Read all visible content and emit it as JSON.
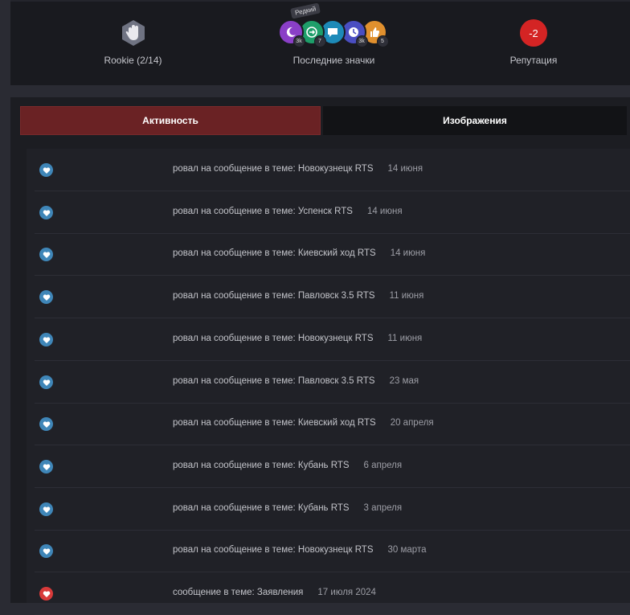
{
  "stats": {
    "rank": {
      "label": "Rookie (2/14)",
      "icon": "rank-hand-icon"
    },
    "badges": {
      "label": "Последние значки",
      "tooltip": "Редкий",
      "items": [
        {
          "icon": "moon-badge-icon",
          "color": "#8a3fc7",
          "count": "3k"
        },
        {
          "icon": "enter-badge-icon",
          "color": "#1e9e6a",
          "count": "7"
        },
        {
          "icon": "chat-badge-icon",
          "color": "#1d8ab8",
          "count": ""
        },
        {
          "icon": "clock-badge-icon",
          "color": "#4a4ec1",
          "count": "3k"
        },
        {
          "icon": "thumbs-up-badge-icon",
          "color": "#e0902e",
          "count": "5"
        }
      ]
    },
    "reputation": {
      "value": "-2",
      "label": "Репутация"
    }
  },
  "tabs": [
    {
      "label": "Активность",
      "active": true
    },
    {
      "label": "Изображения",
      "active": false
    }
  ],
  "activity": [
    {
      "text": "ровал на сообщение в теме: Новокузнецк RTS",
      "date": "14 июня"
    },
    {
      "text": "ровал на сообщение в теме: Успенск RTS",
      "date": "14 июня"
    },
    {
      "text": "ровал на сообщение в теме: Киевский ход RTS",
      "date": "14 июня"
    },
    {
      "text": "ровал на сообщение в теме: Павловск 3.5 RTS",
      "date": "11 июня"
    },
    {
      "text": "ровал на сообщение в теме: Новокузнецк RTS",
      "date": "11 июня"
    },
    {
      "text": "ровал на сообщение в теме: Павловск 3.5 RTS",
      "date": "23 мая"
    },
    {
      "text": "ровал на сообщение в теме: Киевский ход RTS",
      "date": "20 апреля"
    },
    {
      "text": "ровал на сообщение в теме: Кубань RTS",
      "date": "6 апреля"
    },
    {
      "text": "ровал на сообщение в теме: Кубань RTS",
      "date": "3 апреля"
    },
    {
      "text": "ровал на сообщение в теме: Новокузнецк RTS",
      "date": "30 марта"
    },
    {
      "text": "сообщение в теме: Заявления",
      "date": "17 июля 2024"
    }
  ]
}
